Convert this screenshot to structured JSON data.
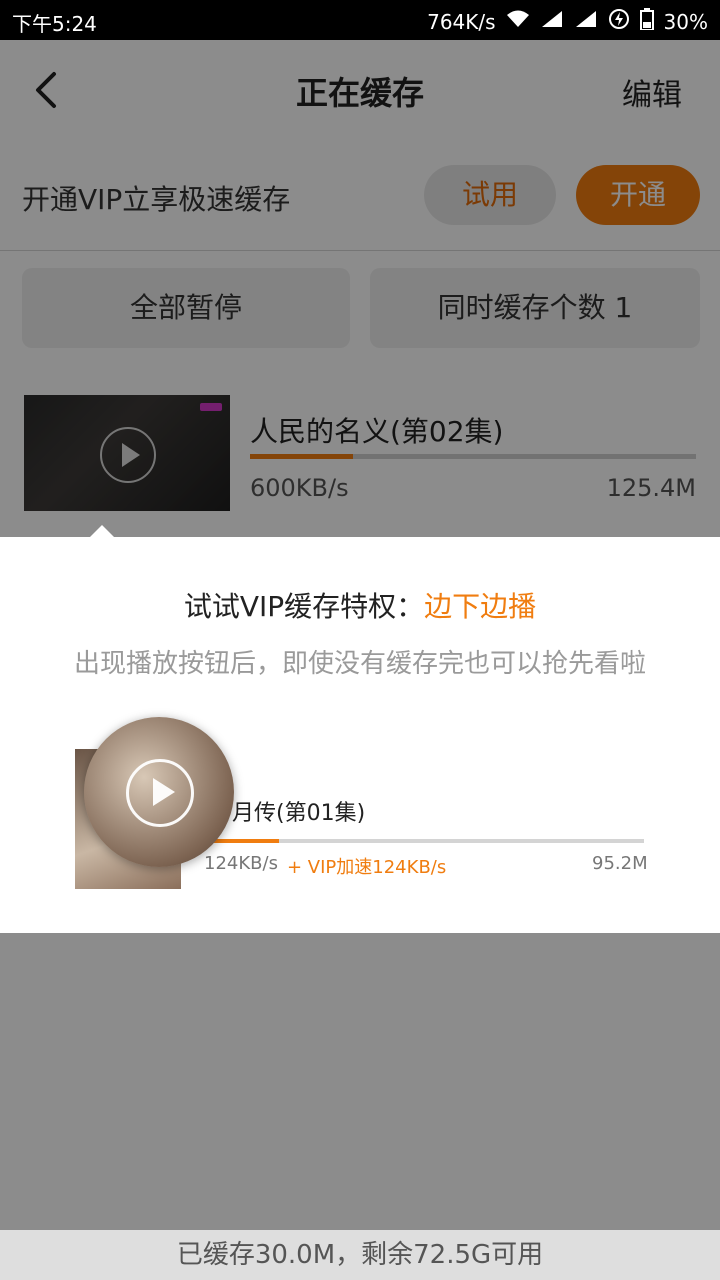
{
  "status_bar": {
    "time": "下午5:24",
    "net_speed": "764K/s",
    "battery": "30%"
  },
  "navbar": {
    "title": "正在缓存",
    "edit_label": "编辑"
  },
  "vip_bar": {
    "text": "开通VIP立享极速缓存",
    "try_label": "试用",
    "open_label": "开通"
  },
  "actions": {
    "pause_all": "全部暂停",
    "concurrent": "同时缓存个数 1"
  },
  "download_item": {
    "title": "人民的名义(第02集)",
    "speed": "600KB/s",
    "size": "125.4M",
    "progress": 0.23
  },
  "popup": {
    "title_prefix": "试试VIP缓存特权：",
    "title_highlight": "边下边播",
    "description": "出现播放按钮后，即使没有缓存完也可以抢先看啦",
    "demo": {
      "title": "月传(第01集)",
      "speed": "124KB/s",
      "vip_speed": "+ VIP加速124KB/s",
      "size": "95.2M",
      "progress": 0.17
    }
  },
  "footer": {
    "storage": "已缓存30.0M，剩余72.5G可用"
  },
  "colors": {
    "accent": "#f07d10",
    "overlay": "rgba(0,0,0,0.45)"
  }
}
